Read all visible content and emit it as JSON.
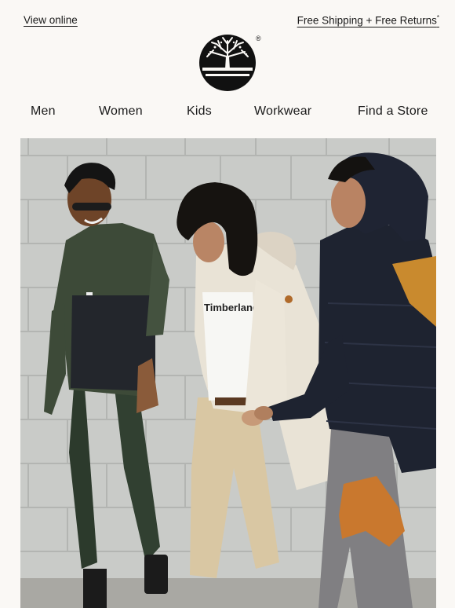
{
  "header": {
    "view_online": "View online",
    "shipping": "Free Shipping + Free Returns",
    "shipping_mark": "*",
    "logo_icon": "tree-logo-icon",
    "registered_mark": "®"
  },
  "nav": {
    "items": [
      {
        "label": "Men"
      },
      {
        "label": "Women"
      },
      {
        "label": "Kids"
      },
      {
        "label": "Workwear"
      },
      {
        "label": "Find a Store"
      }
    ]
  },
  "hero": {
    "shirt_print": "Timberland",
    "colors": {
      "wall": "#c9cbc8",
      "green_jacket": "#3d4a38",
      "cream_parka": "#e9e3d6",
      "navy_puffer": "#1e2330",
      "wheat_accent": "#c98a2e"
    }
  }
}
